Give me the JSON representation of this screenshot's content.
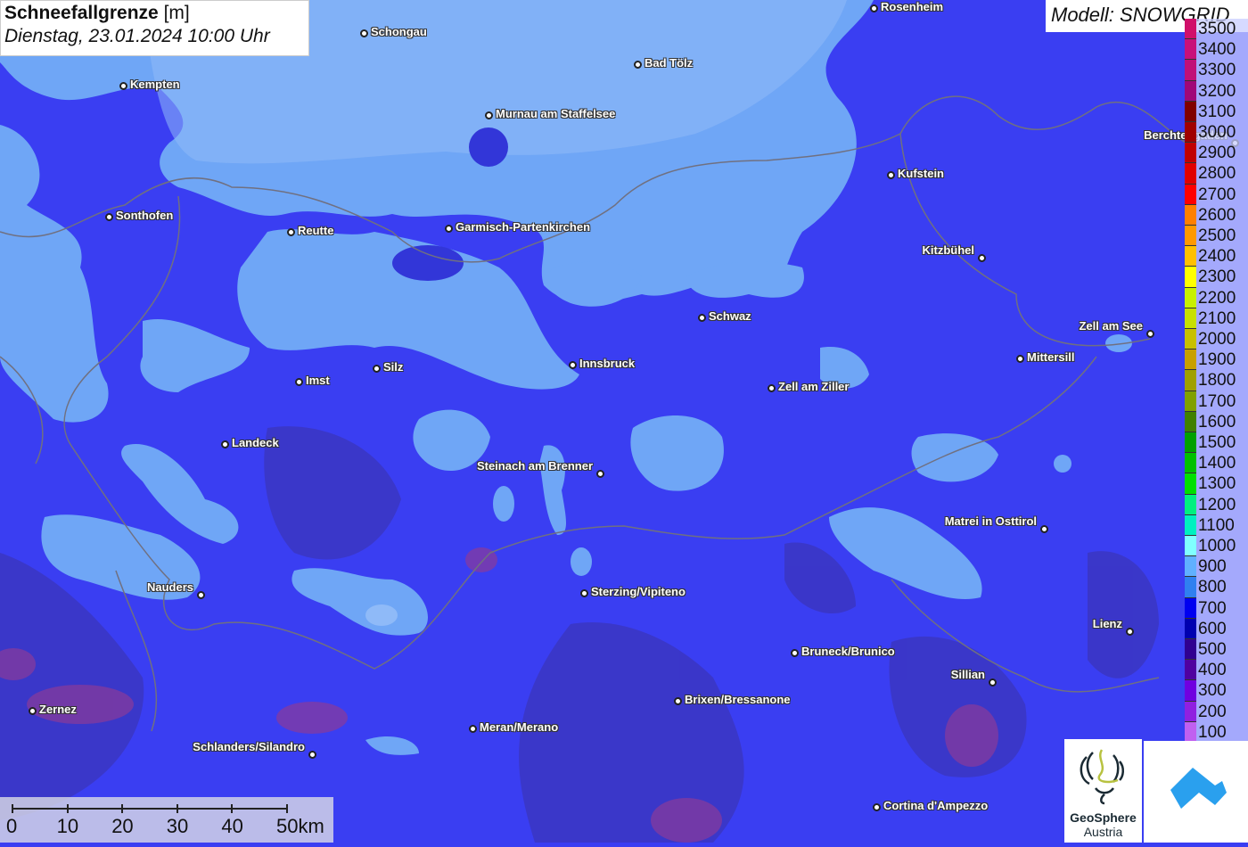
{
  "header": {
    "title_bold": "Schneefallgrenze",
    "title_unit": "[m]",
    "subtitle": "Dienstag, 23.01.2024 10:00 Uhr"
  },
  "model_label": "Modell: SNOWGRID",
  "cities": [
    "Schongau",
    "Rosenheim",
    "Kempten",
    "Bad Tölz",
    "Murnau am Staffelsee",
    "Berchtesgaden",
    "Kufstein",
    "Sonthofen",
    "Reutte",
    "Garmisch-Partenkirchen",
    "Kitzbühel",
    "Schwaz",
    "Zell am See",
    "Mittersill",
    "Silz",
    "Innsbruck",
    "Imst",
    "Zell am Ziller",
    "Landeck",
    "Steinach am Brenner",
    "Matrei in Osttirol",
    "Nauders",
    "Sterzing/Vipiteno",
    "Lienz",
    "Bruneck/Brunico",
    "Sillian",
    "Brixen/Bressanone",
    "Zernez",
    "Meran/Merano",
    "Schlanders/Silandro",
    "Cortina d'Ampezzo"
  ],
  "legend": {
    "labels": [
      "3500",
      "3400",
      "3300",
      "3200",
      "3100",
      "3000",
      "2900",
      "2800",
      "2700",
      "2600",
      "2500",
      "2400",
      "2300",
      "2200",
      "2100",
      "2000",
      "1900",
      "1800",
      "1700",
      "1600",
      "1500",
      "1400",
      "1300",
      "1200",
      "1100",
      "1000",
      "900",
      "800",
      "700",
      "600",
      "500",
      "400",
      "300",
      "200",
      "100"
    ],
    "colors": [
      "#d0106a",
      "#c8107a",
      "#c01078",
      "#a00878",
      "#800000",
      "#a00000",
      "#c00000",
      "#e00000",
      "#ff0000",
      "#ff8000",
      "#ff9900",
      "#ffc000",
      "#ffff00",
      "#c8f000",
      "#c8e000",
      "#c8c000",
      "#c8a000",
      "#a0a000",
      "#80a000",
      "#408000",
      "#00a000",
      "#00c000",
      "#00e000",
      "#00f080",
      "#00f0c0",
      "#80ffff",
      "#60b0ff",
      "#3080f0",
      "#0000f0",
      "#0000b0",
      "#300090",
      "#5000a0",
      "#7000e0",
      "#9020e0",
      "#c060f0"
    ]
  },
  "scale_bar": {
    "labels": [
      "0",
      "10",
      "20",
      "30",
      "40",
      "50km"
    ]
  },
  "logos": {
    "geosphere_line1": "GeoSphere",
    "geosphere_line2": "Austria"
  }
}
